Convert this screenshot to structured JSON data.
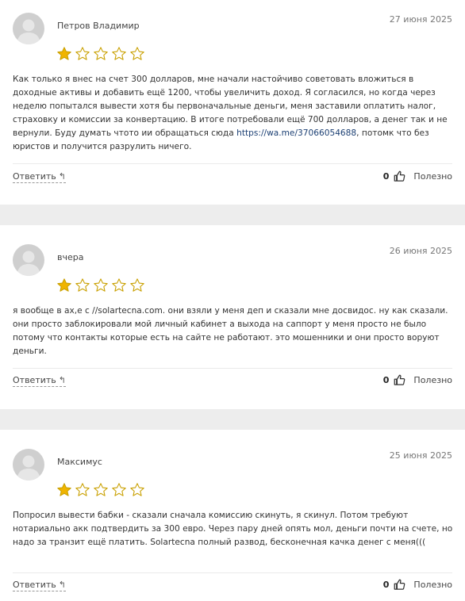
{
  "colors": {
    "star_filled": "#f0b400",
    "star_empty": "#c9a000"
  },
  "reviews": [
    {
      "author": "Петров Владимир",
      "date": "27 июня 2025",
      "rating": 1,
      "rating_max": 5,
      "text_before": "Как только я внес на счет 300 долларов, мне начали настойчиво советовать вложиться в доходные активы и добавить ещё 1200, чтобы увеличить доход. Я согласился, но когда через неделю попытался вывести хотя бы первоначальные деньги, меня заставили оплатить налог, страховку и комиссии за конвертацию. В итоге потребовали ещё 700 долларов, а денег так и не вернули. Буду думать чтото ии обращаться сюда ",
      "link": "https://wa.me/37066054688",
      "text_after": ", потомк что без юристов и получится разрулить ничего.",
      "reply_label": "Ответить",
      "likes": "0",
      "helpful_label": "Полезно"
    },
    {
      "author": "вчера",
      "date": "26 июня 2025",
      "rating": 1,
      "rating_max": 5,
      "text_before": "я вообще в ах,е с //solartecna.com. они взяли у меня деп и сказали мне досвидос. ну как сказали. они просто заблокировали мой личный кабинет а выхода на саппорт у меня просто не было потому что контакты которые есть на сайте не работают. это мошенники и они просто воруют деньги.",
      "link": "",
      "text_after": "",
      "reply_label": "Ответить",
      "likes": "0",
      "helpful_label": "Полезно"
    },
    {
      "author": "Максимус",
      "date": "25 июня 2025",
      "rating": 1,
      "rating_max": 5,
      "text_before": "Попросил вывести бабки - сказали сначала комиссию скинуть, я скинул. Потом требуют нотариально акк подтвердить за 300 евро. Через пару дней опять мол, деньги почти на счете, но надо за транзит ещё платить. Solartecna полный развод, бесконечная качка денег с меня(((",
      "link": "",
      "text_after": "",
      "reply_label": "Ответить",
      "likes": "0",
      "helpful_label": "Полезно"
    }
  ]
}
